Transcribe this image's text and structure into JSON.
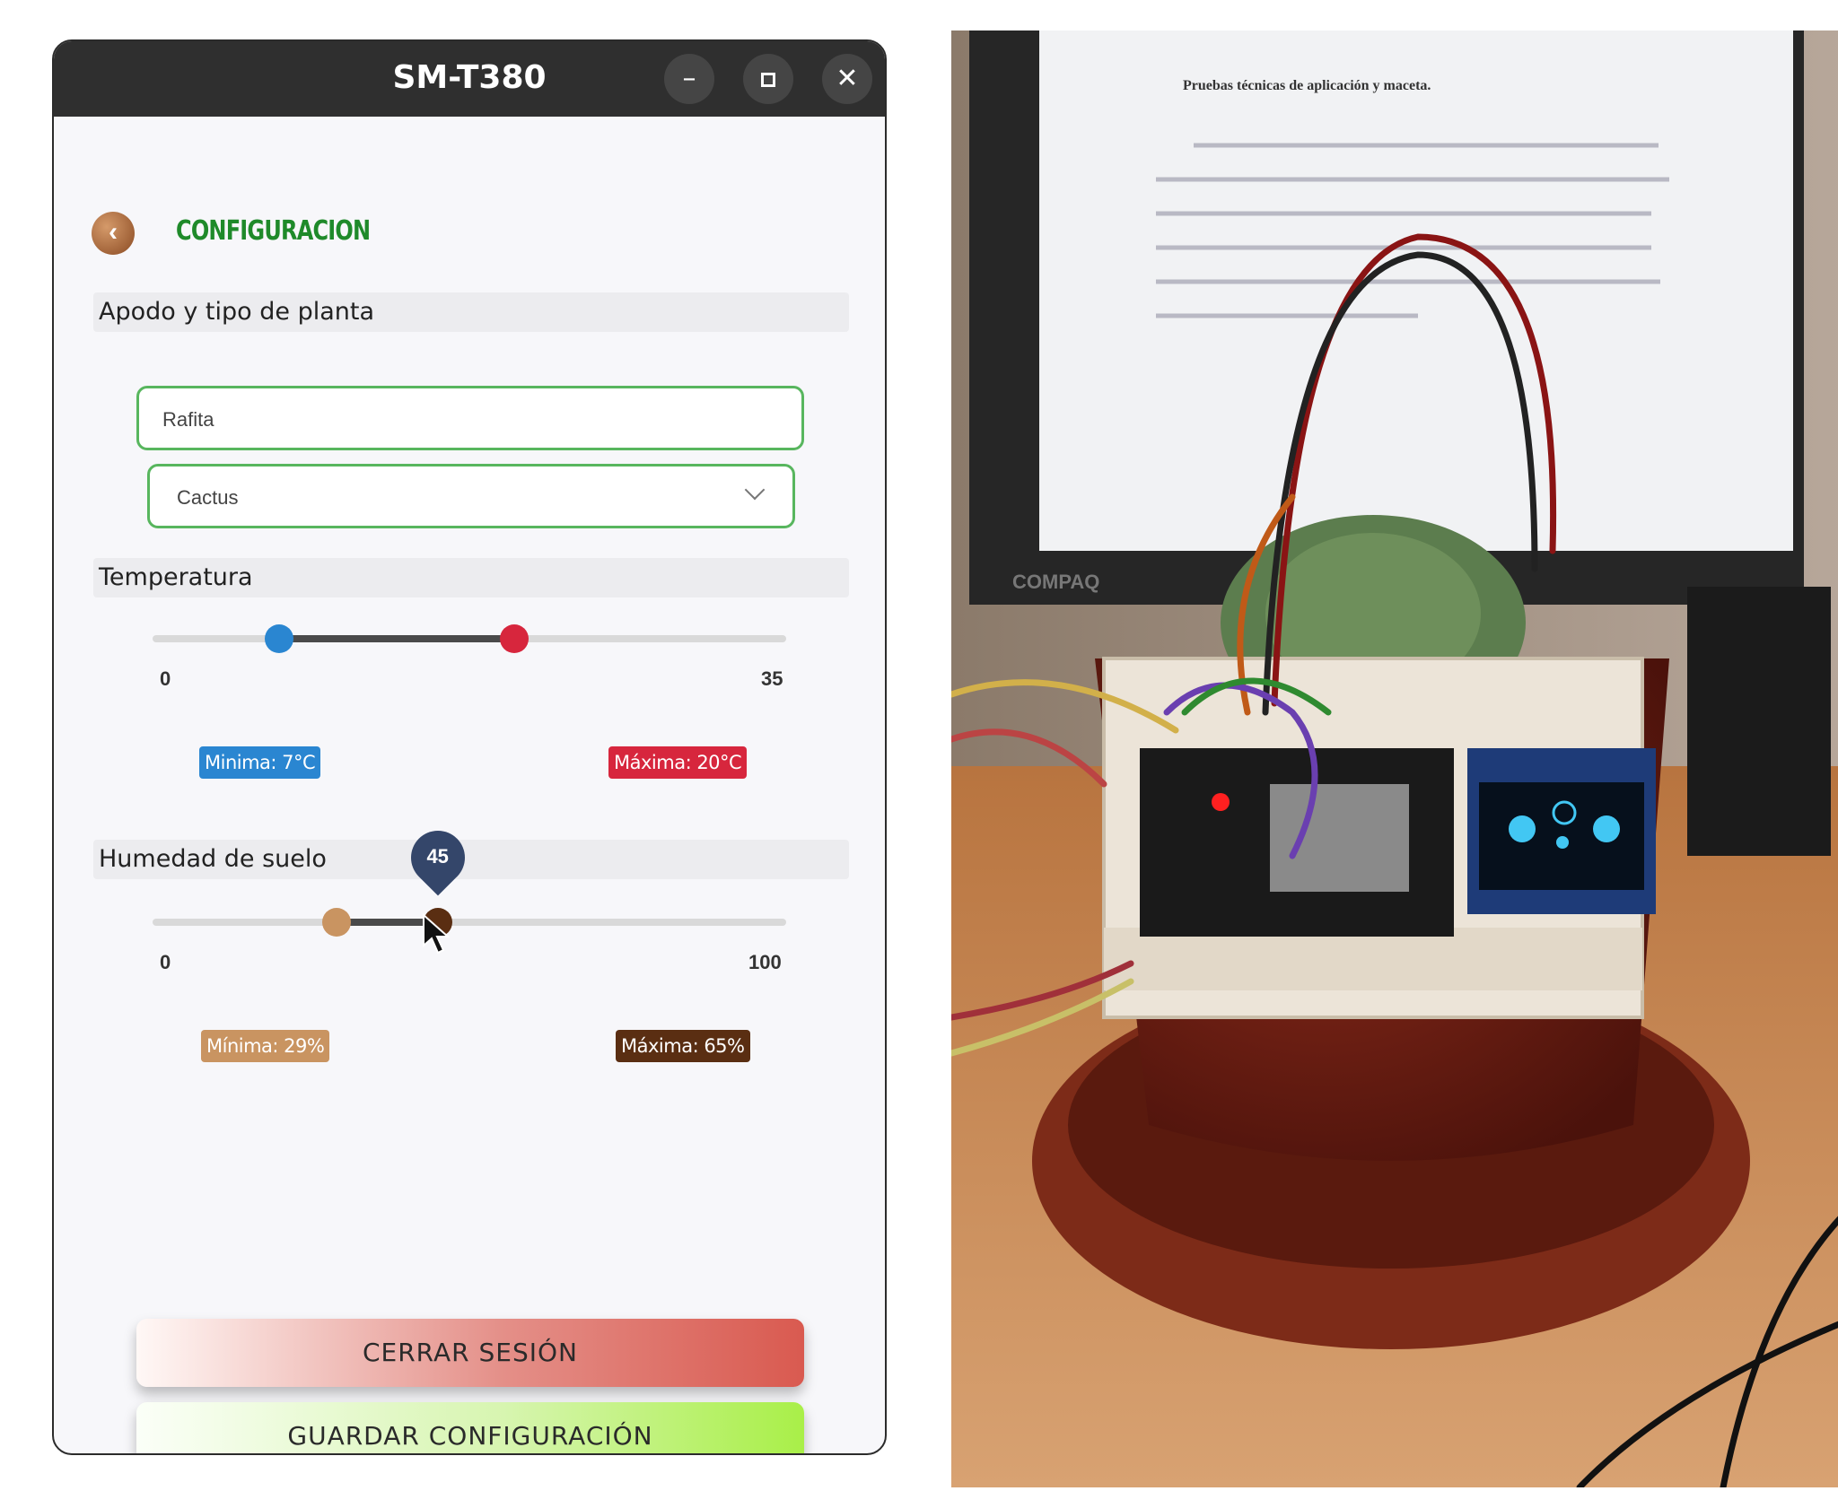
{
  "window": {
    "title": "SM-T380",
    "controls": {
      "minimize": "–",
      "maximize": "□",
      "close": "✕"
    }
  },
  "header": {
    "back_icon": "chevron-left-icon",
    "title": "CONFIGURACION"
  },
  "sections": {
    "plant": {
      "label": "Apodo y tipo de planta",
      "nickname_value": "Rafita",
      "plant_type_value": "Cactus"
    },
    "temperature": {
      "label": "Temperatura",
      "min_tick": "0",
      "max_tick": "35",
      "range": [
        0,
        35
      ],
      "low_value": 7,
      "high_value": 20,
      "min_chip": "Minima: 7°C",
      "max_chip": "Máxima: 20°C"
    },
    "humidity": {
      "label": "Humedad de suelo",
      "min_tick": "0",
      "max_tick": "100",
      "range": [
        0,
        100
      ],
      "low_value": 29,
      "high_value": 45,
      "tooltip": "45",
      "min_chip": "Mínima: 29%",
      "max_chip": "Máxima: 65%"
    }
  },
  "buttons": {
    "logout": "CERRAR SESIÓN",
    "save": "GUARDAR CONFIGURACIÓN"
  },
  "colors": {
    "temp_min": "#2a86d1",
    "temp_max": "#d7263d",
    "hum_min": "#c99461",
    "hum_max": "#5a2e12",
    "accent_green": "#58b65e"
  },
  "photo": {
    "document_title": "Pruebas técnicas de aplicación y maceta.",
    "monitor_brand": "COMPAQ"
  }
}
